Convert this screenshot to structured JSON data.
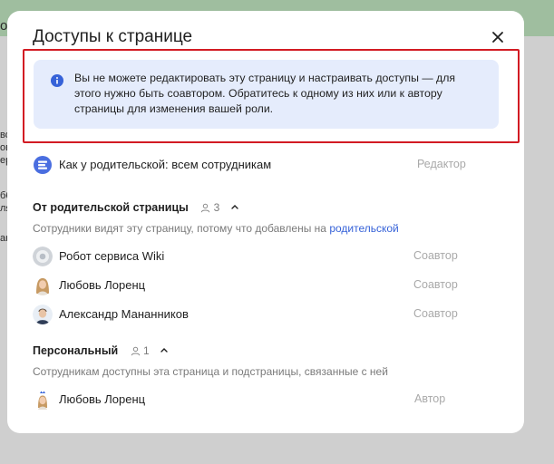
{
  "background": {
    "fragments": [
      "o",
      "во",
      "ов",
      "ер",
      "бб",
      "ля",
      "ан"
    ]
  },
  "modal": {
    "title": "Доступы к странице",
    "close_icon": "close-icon"
  },
  "notice": {
    "icon": "info-icon",
    "text": "Вы не можете редактировать эту страницу и настраивать доступы — для этого нужно быть соавтором. Обратитесь к одному из них или к автору страницы для изменения вашей роли."
  },
  "inherit_row": {
    "icon": "inherit-access-icon",
    "label": "Как у родительской: всем сотрудникам",
    "role": "Редактор"
  },
  "parent_section": {
    "title": "От родительской страницы",
    "count": "3",
    "description_prefix": "Сотрудники видят эту страницу, потому что добавлены на ",
    "description_link": "родительской",
    "members": [
      {
        "name": "Робот сервиса Wiki",
        "role": "Соавтор",
        "avatar": "robot-avatar"
      },
      {
        "name": "Любовь Лоренц",
        "role": "Соавтор",
        "avatar": "female-avatar"
      },
      {
        "name": "Александр Мананников",
        "role": "Соавтор",
        "avatar": "male-avatar"
      }
    ]
  },
  "personal_section": {
    "title": "Персональный",
    "count": "1",
    "description": "Сотрудникам доступны эта страница и подстраницы, связанные с ней",
    "members": [
      {
        "name": "Любовь Лоренц",
        "role": "Автор",
        "avatar": "female-avatar-crown"
      }
    ]
  },
  "colors": {
    "accent_link": "#3662d8",
    "notice_bg": "#e5ecfc",
    "highlight_border": "#d21b23",
    "muted_text": "#a9a9a9"
  }
}
